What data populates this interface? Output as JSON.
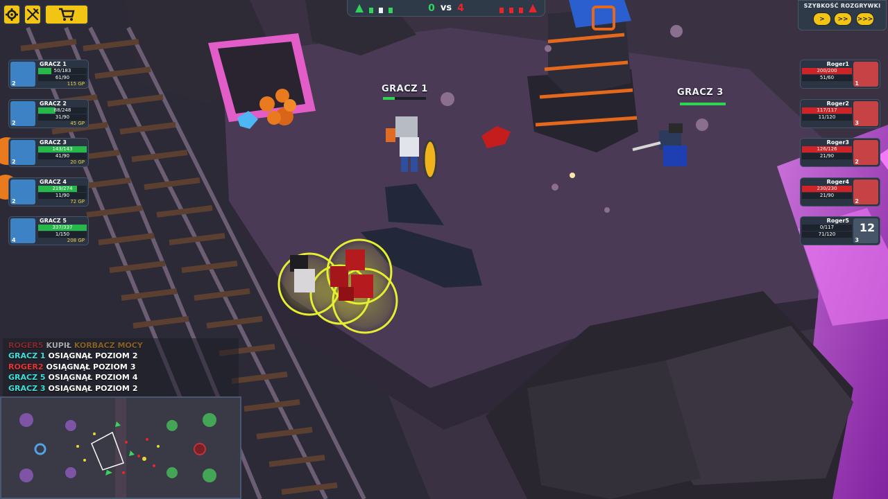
{
  "top_left": {
    "settings_icon": "gear-icon",
    "skills_icon": "crossed-swords-icon",
    "shop_icon": "cart-icon"
  },
  "scoreboard": {
    "left_score": "0",
    "vs": "vs",
    "right_score": "4",
    "left_color": "#31d35b",
    "right_color": "#e6262b"
  },
  "speed": {
    "title": "SZYBKOŚĆ ROZGRYWKI",
    "buttons": [
      ">",
      ">>",
      ">>>"
    ]
  },
  "left_team": [
    {
      "name": "GRACZ 1",
      "hp": "50/183",
      "hp_fraction": 0.27,
      "mp": "61/90",
      "gp": "115 GP",
      "level": "2"
    },
    {
      "name": "GRACZ 2",
      "hp": "88/248",
      "hp_fraction": 0.35,
      "mp": "31/90",
      "gp": "45 GP",
      "level": "2"
    },
    {
      "name": "GRACZ 3",
      "hp": "143/143",
      "hp_fraction": 1.0,
      "mp": "41/90",
      "gp": "20 GP",
      "level": "2"
    },
    {
      "name": "GRACZ 4",
      "hp": "219/274",
      "hp_fraction": 0.8,
      "mp": "11/90",
      "gp": "72 GP",
      "level": "2"
    },
    {
      "name": "GRACZ 5",
      "hp": "337/337",
      "hp_fraction": 1.0,
      "mp": "1/150",
      "gp": "208 GP",
      "level": "4"
    }
  ],
  "right_team": [
    {
      "name": "Roger1",
      "hp": "200/200",
      "hp_fraction": 1.0,
      "mp": "51/60",
      "level": "1"
    },
    {
      "name": "Roger2",
      "hp": "117/117",
      "hp_fraction": 1.0,
      "mp": "11/120",
      "level": "3"
    },
    {
      "name": "Roger3",
      "hp": "126/126",
      "hp_fraction": 1.0,
      "mp": "21/90",
      "level": "2"
    },
    {
      "name": "Roger4",
      "hp": "230/230",
      "hp_fraction": 1.0,
      "mp": "21/90",
      "level": "2"
    },
    {
      "name": "Roger5",
      "hp": "0/117",
      "hp_fraction": 0.0,
      "mp": "71/120",
      "level": "3",
      "respawn": "12"
    }
  ],
  "world": {
    "player1_label": "GRACZ 1",
    "player1_hp_fraction": 0.27,
    "player3_label": "GRACZ 3",
    "player3_hp_fraction": 1.0
  },
  "log": [
    {
      "who": "ROGER5",
      "who_color": "#c0302f",
      "text": "KUPIŁ",
      "item": "KORBACZ MOCY",
      "item_color": "#c88a1e",
      "num": ""
    },
    {
      "who": "GRACZ 1",
      "who_color": "#3ee0d9",
      "text": "OSIĄGNĄŁ POZIOM",
      "item": "",
      "item_color": "",
      "num": "2"
    },
    {
      "who": "ROGER2",
      "who_color": "#e83534",
      "text": "OSIĄGNĄŁ POZIOM",
      "item": "",
      "item_color": "",
      "num": "3"
    },
    {
      "who": "GRACZ 5",
      "who_color": "#3ee0d9",
      "text": "OSIĄGNĄŁ POZIOM",
      "item": "",
      "item_color": "",
      "num": "4"
    },
    {
      "who": "GRACZ 3",
      "who_color": "#3ee0d9",
      "text": "OSIĄGNĄŁ POZIOM",
      "item": "",
      "item_color": "",
      "num": "2"
    }
  ]
}
